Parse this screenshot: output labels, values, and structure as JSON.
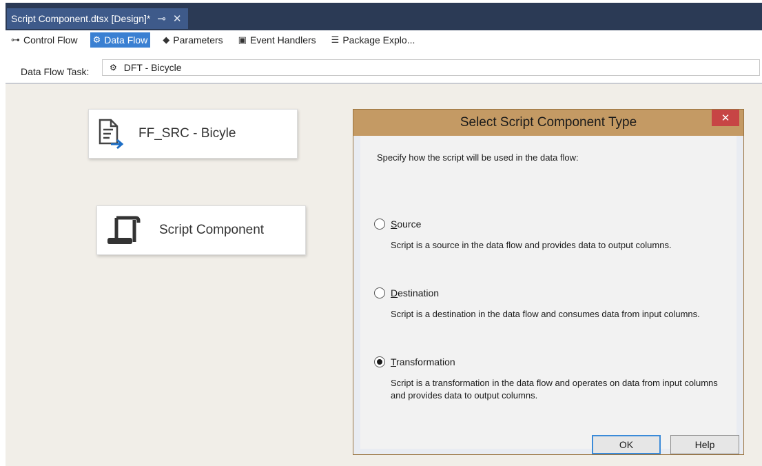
{
  "document_tab": {
    "title": "Script Component.dtsx [Design]*",
    "pin_icon": "pin-icon",
    "close_icon": "close-icon"
  },
  "designer_tabs": [
    {
      "label": "Control Flow",
      "icon": "control-flow-icon",
      "active": false
    },
    {
      "label": "Data Flow",
      "icon": "data-flow-icon",
      "active": true
    },
    {
      "label": "Parameters",
      "icon": "parameters-icon",
      "active": false
    },
    {
      "label": "Event Handlers",
      "icon": "event-handlers-icon",
      "active": false
    },
    {
      "label": "Package Explo...",
      "icon": "package-explorer-icon",
      "active": false
    }
  ],
  "task_bar": {
    "label": "Data Flow Task:",
    "selected": "DFT - Bicycle",
    "icon": "data-flow-task-icon"
  },
  "components": [
    {
      "label": "FF_SRC - Bicyle",
      "icon": "flat-file-source-icon"
    },
    {
      "label": "Script Component",
      "icon": "script-component-icon"
    }
  ],
  "dialog": {
    "title": "Select Script Component Type",
    "close_label": "✕",
    "instruction": "Specify how the script will be used in the data flow:",
    "options": [
      {
        "accel": "S",
        "rest": "ource",
        "description": "Script is a source in the data flow and provides data to output columns.",
        "selected": false
      },
      {
        "accel": "D",
        "rest": "estination",
        "description": "Script is a destination in the data flow and consumes data from input columns.",
        "selected": false
      },
      {
        "accel": "T",
        "rest": "ransformation",
        "description": "Script is a transformation in the data flow and operates on data from input columns and provides data to output columns.",
        "selected": true
      }
    ],
    "ok_label": "OK",
    "help_label": "Help"
  },
  "colors": {
    "tab_strip": "#2b3a55",
    "active_tab": "#3a80d2",
    "canvas": "#f1eee8",
    "dialog_frame": "#c49a64",
    "close_button": "#c74545"
  }
}
